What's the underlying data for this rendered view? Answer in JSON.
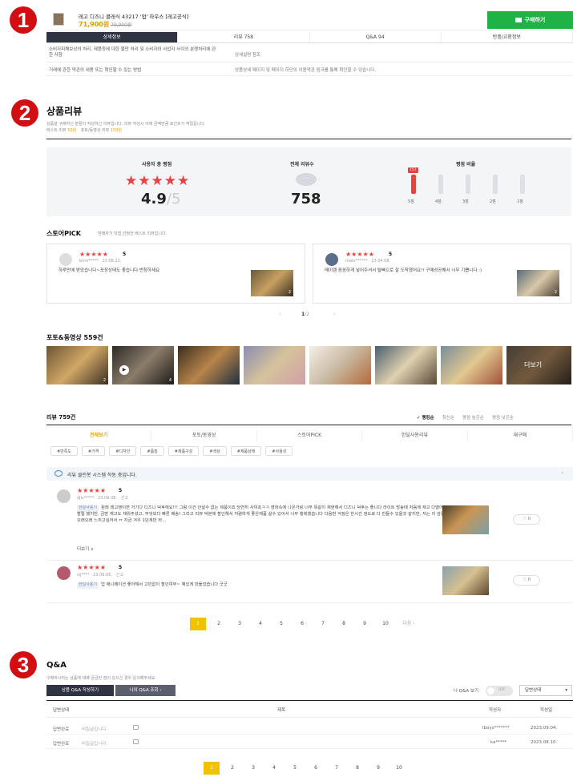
{
  "markers": [
    "1",
    "2",
    "3"
  ],
  "product": {
    "name": "레고 디즈니 클래식 43217 '업' 하우스 [레고공식]",
    "price": "71,900원",
    "original_price": "79,900원",
    "buy_label": "구매하기"
  },
  "tabs": [
    "상세정보",
    "리뷰 758",
    "Q&A 94",
    "반품/교환정보"
  ],
  "info_rows": [
    {
      "key": "소비자피해보상의 처리, 제품등에 대한 불만 처리 및 소비자와 사업자 사이의 분쟁처리에 관한 사항",
      "value": "상세설명 참조"
    },
    {
      "key": "거래에 관한 약관의 내용 또는 확인할 수 있는 방법",
      "value": "상품상세 페이지 및 페이지 하단의 이용약관 링크를 통해 확인할 수 있습니다."
    }
  ],
  "reviews_section": {
    "title": "상품리뷰",
    "desc": "상품을 구매하신 분들이 작성하신 리뷰입니다. 리뷰 작성시 아래 금액만큼 포인트가 적립됩니다.",
    "points_text_label": "텍스트 리뷰",
    "points_text_value": "50원",
    "points_photo_label": "포토/동영상 리뷰",
    "points_photo_value": "150원",
    "summary": {
      "rating_title": "사용자 총 평점",
      "stars": "★★★★★",
      "rating": "4.9",
      "rating_max": "/5",
      "count_title": "전체 리뷰수",
      "count": "758",
      "ratio_title": "평점 비율",
      "ratio_badge": "757",
      "ratio_labels": [
        "5점",
        "4점",
        "3점",
        "2점",
        "1점"
      ],
      "ratio_values": [
        0.99,
        0.002,
        0.001,
        0.001,
        0.001
      ]
    }
  },
  "store_pick": {
    "title": "스토어PICK",
    "desc": "판매자가 직접 선정한 베스트 리뷰입니다.",
    "cards": [
      {
        "stars": "★★★★★",
        "score": "5",
        "meta": "bnm***** · 23.08.22.",
        "text": "하루만에 받았습니다~포장상태도 좋습니다.번창하세요",
        "count": "2"
      },
      {
        "stars": "★★★★★",
        "score": "5",
        "meta": "mats****** · 23.04.08.",
        "text": "메이캠 꼼꼼하게 넣어주셔서 탈빠으로 잘 도착했어요!! 구매성공해서 너무 기쁩니다 :)",
        "count": "2"
      }
    ],
    "page": "1",
    "page_total": "/2"
  },
  "photos": {
    "title": "포토&동영상 559건",
    "more_label": "더보기",
    "badges": [
      "2",
      "4",
      "",
      "",
      "",
      "",
      "",
      ""
    ]
  },
  "review_list": {
    "title": "리뷰 759건",
    "sorts": [
      "✓ 랭킹순",
      "최신순",
      "평점 높은순",
      "평점 낮은순"
    ],
    "filters": [
      "전체보기",
      "포토/동영상",
      "스토어PICK",
      "한달사용리뷰",
      "재구매"
    ],
    "chips": [
      "#만족도",
      "#가격",
      "#디자인",
      "#품질",
      "#제품구성",
      "#색상",
      "#제품상태",
      "#사용성"
    ],
    "cleanbot": "리뷰 클린봇 시스템 작동 중입니다.",
    "reviews": [
      {
        "stars": "★★★★★",
        "score": "5",
        "meta": "djiv***** · 23.09.08. · 신고",
        "tag": "한달사용기",
        "text": "원래 레고쟁이면 거기다 디즈니 덕후에요!!! 그럼 이건 안살수 없는 제품이죠 당연히 사야죠ㅋㅋ 영화속에 나온거랑 너무 똑같이 재현해서 디즈니 덕후는 좋니다 라이트 방송때 처음에 제고 다떨어져서 할릴 했지만, 금방 재고도 채워주셨고, 무엇보다 빠른 배송! 그리고 리뷰 덕분에 할인해서 저렴하게 좋은제품 살수 있어서 너무 행복했습니다 다음번 걱정은 한시간 정도로 다 만들수 있을것 같지만, 저는 이 감동을 오래오래 느끼고싶어서 ㅠ 지금 겨우 1단계만 하...",
        "more": "더보기 ∨",
        "likes": "0"
      },
      {
        "stars": "★★★★★",
        "score": "5",
        "meta": "sij**** · 23.09.06. · 신고",
        "tag": "한달사용기",
        "text": "업 애니메이션 좋아해서 고민없이 할인여부~ 혜있게 만들었습니다 굿굿",
        "more": "",
        "likes": "0"
      }
    ],
    "pages": [
      "1",
      "2",
      "3",
      "4",
      "5",
      "6",
      "7",
      "8",
      "9",
      "10"
    ],
    "next_label": "다음 ›"
  },
  "qa": {
    "title": "Q&A",
    "desc": "구매하시려는 상품에 대해 궁금한 점이 있으신 경우 문의해주세요.",
    "write_btn": "상품 Q&A 작성하기",
    "my_btn": "나의 Q&A 조회 ›",
    "my_toggle_label": "나 Q&A 보기",
    "toggle_state": "OFF",
    "status_select": "답변상태",
    "headers": [
      "답변상태",
      "제목",
      "작성자",
      "작성일"
    ],
    "rows": [
      {
        "status": "답변완료",
        "title": "비밀글입니다.",
        "author": "lboys*******",
        "date": "2023.09.04."
      },
      {
        "status": "답변완료",
        "title": "비밀글입니다.",
        "author": "ka*****",
        "date": "2023.08.10."
      }
    ],
    "pages": [
      "1",
      "2",
      "3",
      "4",
      "5",
      "6",
      "7",
      "8",
      "9",
      "10"
    ]
  },
  "colors": {
    "accent_red": "#e84141",
    "buy_green": "#1fb345",
    "active_tab": "#303442",
    "page_yellow": "#f2c200",
    "marker_red": "#d40d12"
  }
}
